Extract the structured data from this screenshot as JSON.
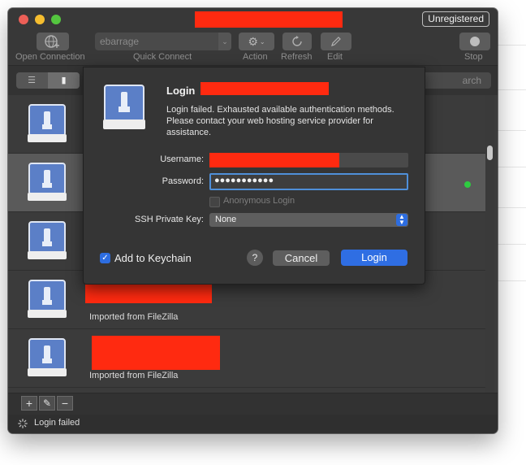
{
  "window": {
    "badge": "Unregistered"
  },
  "toolbar": {
    "open_connection_label": "Open Connection",
    "quick_connect_label": "Quick Connect",
    "quick_connect_value": "ebarrage",
    "action_label": "Action",
    "refresh_label": "Refresh",
    "edit_label": "Edit",
    "stop_label": "Stop"
  },
  "subbar": {
    "search_partial": "arch"
  },
  "list": {
    "rows": [
      {
        "subtitle": ""
      },
      {
        "subtitle": ""
      },
      {
        "subtitle": ""
      },
      {
        "subtitle": "Imported from FileZilla"
      },
      {
        "subtitle": "Imported from FileZilla"
      }
    ]
  },
  "bottom": {
    "add": "+",
    "edit": "✎",
    "remove": "−"
  },
  "status": {
    "text": "Login failed"
  },
  "login": {
    "title": "Login",
    "message": "Login failed. Exhausted available authentication methods. Please contact your web hosting service provider for assistance.",
    "username_label": "Username:",
    "password_label": "Password:",
    "password_mask": "●●●●●●●●●●●",
    "anonymous_label": "Anonymous Login",
    "ssh_key_label": "SSH Private Key:",
    "ssh_key_value": "None",
    "keychain_label": "Add to Keychain",
    "keychain_checked": true,
    "help_label": "?",
    "cancel_label": "Cancel",
    "login_label": "Login"
  },
  "colors": {
    "accent_blue": "#2f6ee3",
    "redaction": "#ff2a10",
    "online_dot": "#2ecc40"
  }
}
